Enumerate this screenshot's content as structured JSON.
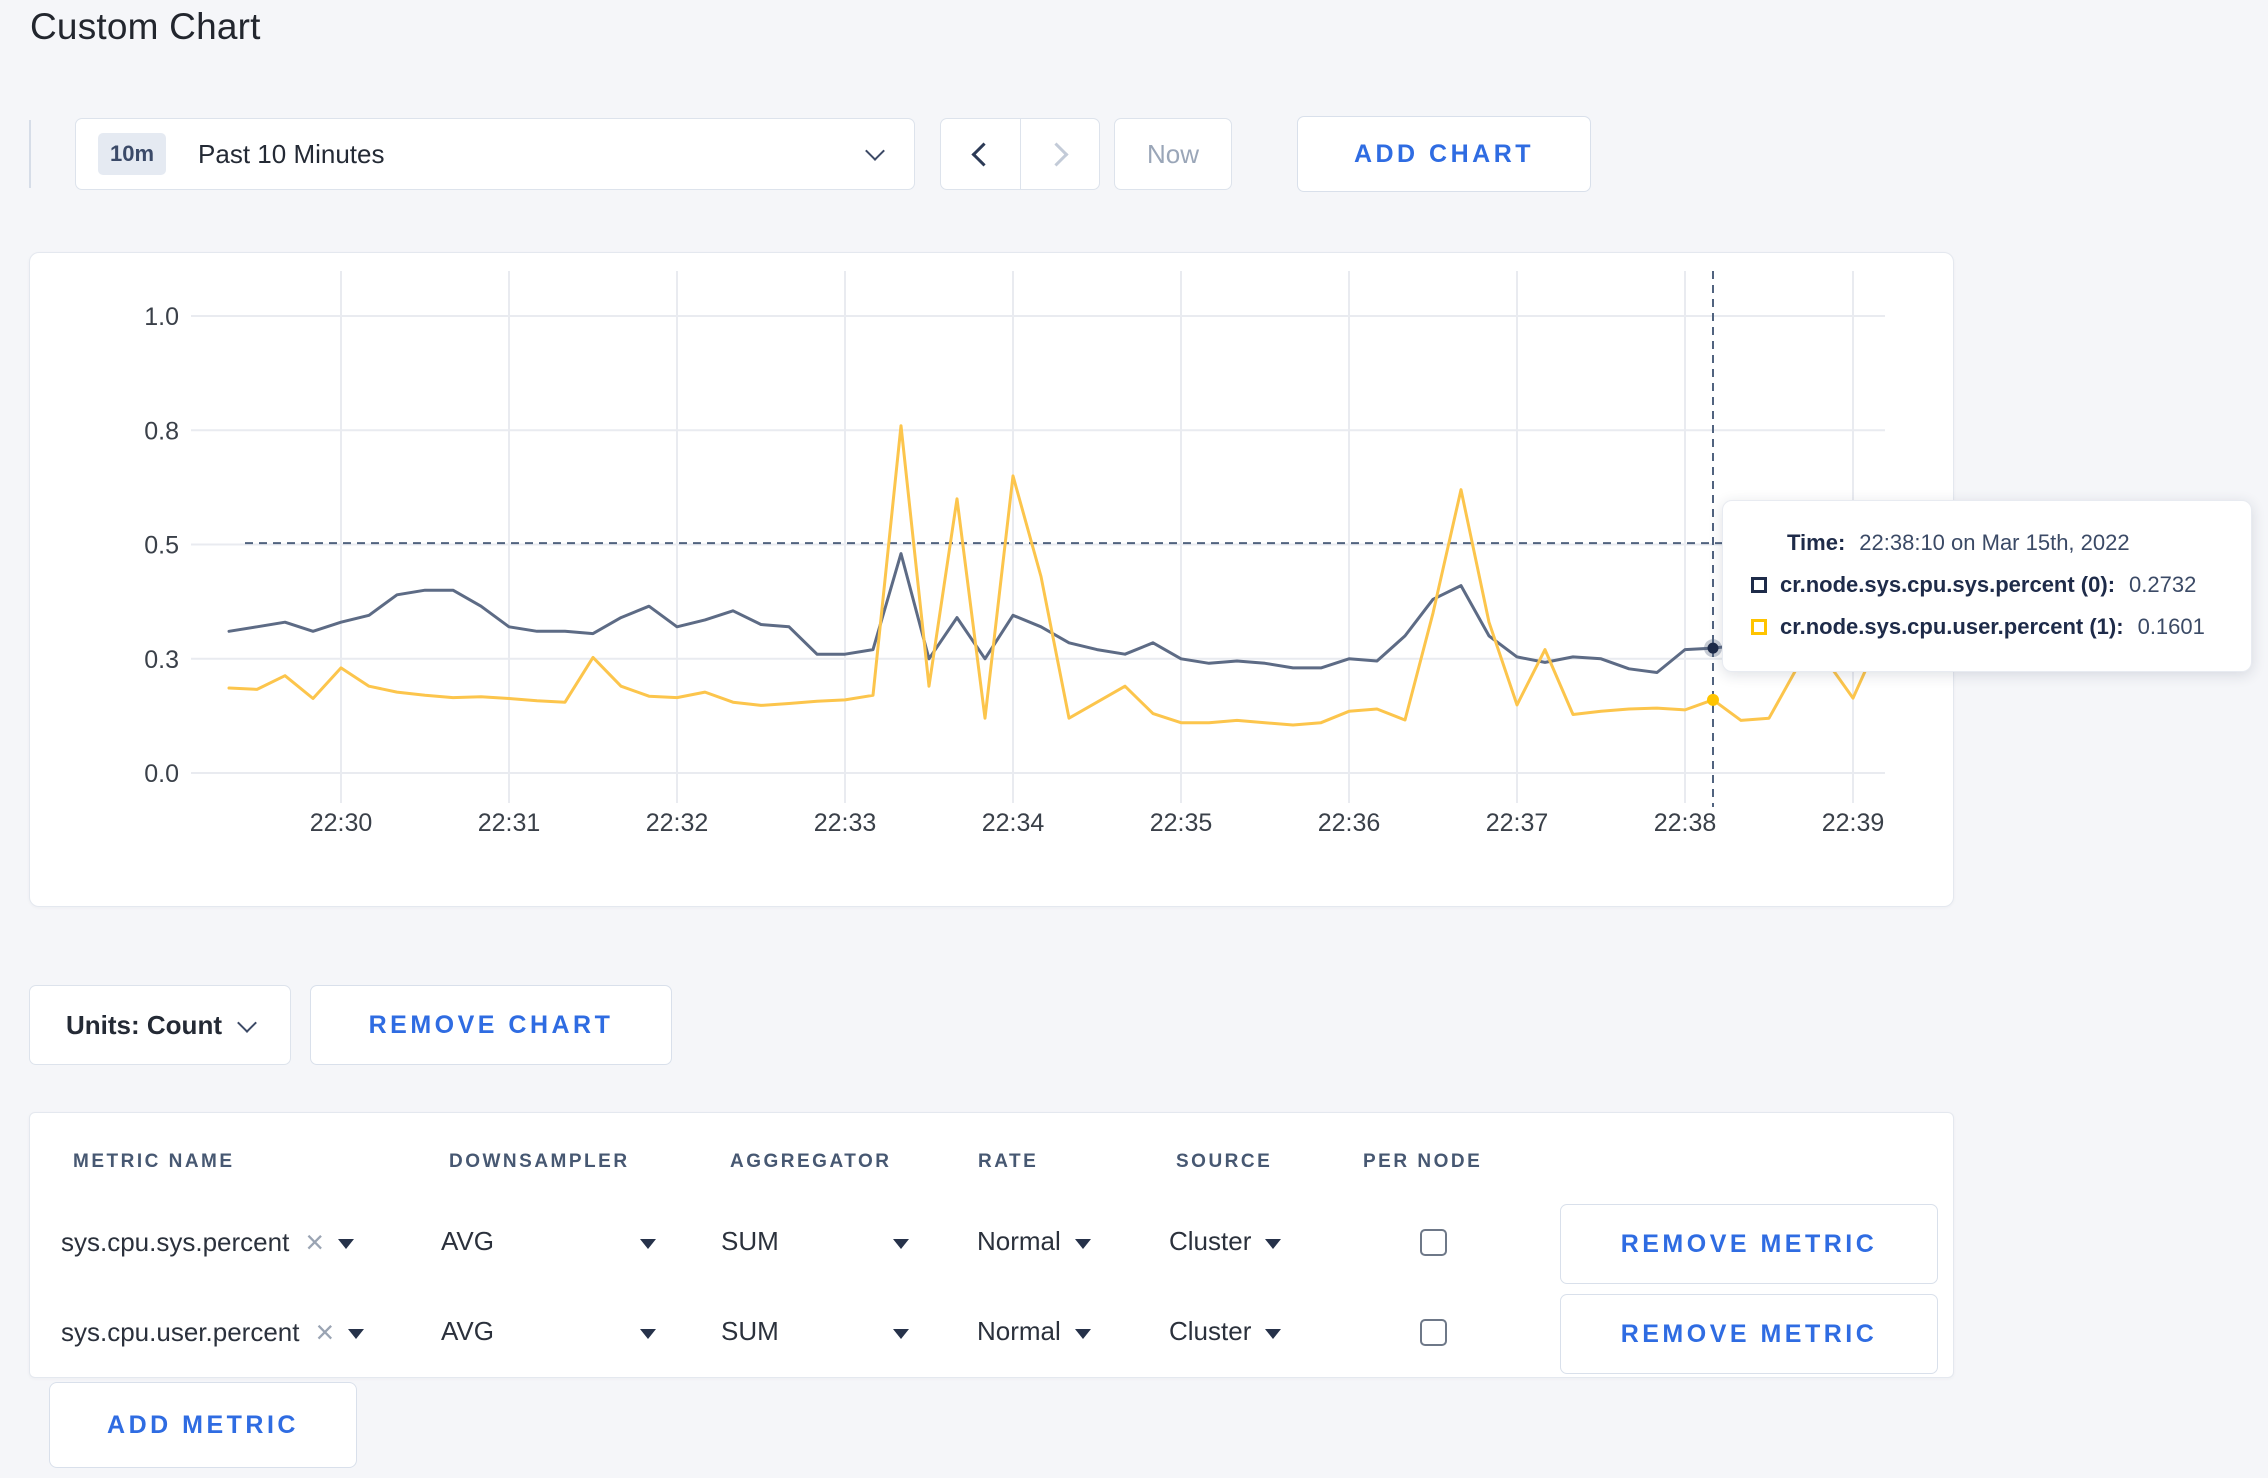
{
  "page": {
    "title": "Custom Chart"
  },
  "toolbar": {
    "time_window_badge": "10m",
    "time_window_label": "Past 10 Minutes",
    "now_label": "Now",
    "add_chart_label": "ADD CHART"
  },
  "tooltip": {
    "time_label": "Time:",
    "time_value": "22:38:10 on Mar 15th, 2022",
    "series": [
      {
        "name": "cr.node.sys.cpu.sys.percent (0):",
        "value": "0.2732",
        "color": "#1e2b49"
      },
      {
        "name": "cr.node.sys.cpu.user.percent (1):",
        "value": "0.1601",
        "color": "#ffc400"
      }
    ]
  },
  "chart_footer": {
    "units_label": "Units: Count",
    "remove_chart_label": "REMOVE CHART"
  },
  "metrics_table": {
    "headers": [
      "METRIC NAME",
      "DOWNSAMPLER",
      "AGGREGATOR",
      "RATE",
      "SOURCE",
      "PER NODE"
    ],
    "rows": [
      {
        "metric": "sys.cpu.sys.percent",
        "downsampler": "AVG",
        "aggregator": "SUM",
        "rate": "Normal",
        "source": "Cluster",
        "per_node_checked": false,
        "remove_label": "REMOVE METRIC"
      },
      {
        "metric": "sys.cpu.user.percent",
        "downsampler": "AVG",
        "aggregator": "SUM",
        "rate": "Normal",
        "source": "Cluster",
        "per_node_checked": false,
        "remove_label": "REMOVE METRIC"
      }
    ],
    "add_metric_label": "ADD METRIC"
  },
  "chart_data": {
    "type": "line",
    "title": "",
    "xlabel": "",
    "ylabel": "",
    "ylim": [
      0.0,
      1.0
    ],
    "grid": true,
    "legend_position": "none",
    "y_tick_values": [
      1.0,
      0.75,
      0.5,
      0.25,
      0.0
    ],
    "y_tick_labels": [
      "1.0",
      "0.8",
      "0.5",
      "0.3",
      "0.0"
    ],
    "x_ticks": [
      "22:30",
      "22:31",
      "22:32",
      "22:33",
      "22:34",
      "22:35",
      "22:36",
      "22:37",
      "22:38",
      "22:39"
    ],
    "crosshair": {
      "time": "22:38:10",
      "hline_value": 0.503,
      "sys_value": 0.2732,
      "user_value": 0.1601
    },
    "colors": {
      "sys": "#5d6b85",
      "user": "#fcc54c",
      "grid": "#e9ebf0",
      "dashed": "#51637f",
      "axis_label": "#3a4049"
    },
    "series": [
      {
        "name": "cr.node.sys.cpu.sys.percent",
        "color": "#5d6b85",
        "points": [
          [
            "22:29:20",
            0.31
          ],
          [
            "22:29:30",
            0.32
          ],
          [
            "22:29:40",
            0.33
          ],
          [
            "22:29:50",
            0.31
          ],
          [
            "22:30:00",
            0.33
          ],
          [
            "22:30:10",
            0.345
          ],
          [
            "22:30:20",
            0.39
          ],
          [
            "22:30:30",
            0.4
          ],
          [
            "22:30:40",
            0.4
          ],
          [
            "22:30:50",
            0.365
          ],
          [
            "22:31:00",
            0.32
          ],
          [
            "22:31:10",
            0.31
          ],
          [
            "22:31:20",
            0.31
          ],
          [
            "22:31:30",
            0.305
          ],
          [
            "22:31:40",
            0.34
          ],
          [
            "22:31:50",
            0.365
          ],
          [
            "22:32:00",
            0.32
          ],
          [
            "22:32:10",
            0.335
          ],
          [
            "22:32:20",
            0.355
          ],
          [
            "22:32:30",
            0.325
          ],
          [
            "22:32:40",
            0.32
          ],
          [
            "22:32:50",
            0.26
          ],
          [
            "22:33:00",
            0.26
          ],
          [
            "22:33:10",
            0.27
          ],
          [
            "22:33:20",
            0.48
          ],
          [
            "22:33:30",
            0.25
          ],
          [
            "22:33:40",
            0.34
          ],
          [
            "22:33:50",
            0.25
          ],
          [
            "22:34:00",
            0.345
          ],
          [
            "22:34:10",
            0.32
          ],
          [
            "22:34:20",
            0.285
          ],
          [
            "22:34:30",
            0.27
          ],
          [
            "22:34:40",
            0.26
          ],
          [
            "22:34:50",
            0.285
          ],
          [
            "22:35:00",
            0.25
          ],
          [
            "22:35:10",
            0.24
          ],
          [
            "22:35:20",
            0.245
          ],
          [
            "22:35:30",
            0.24
          ],
          [
            "22:35:40",
            0.23
          ],
          [
            "22:35:50",
            0.23
          ],
          [
            "22:36:00",
            0.25
          ],
          [
            "22:36:10",
            0.245
          ],
          [
            "22:36:20",
            0.3
          ],
          [
            "22:36:30",
            0.38
          ],
          [
            "22:36:40",
            0.41
          ],
          [
            "22:36:50",
            0.3
          ],
          [
            "22:37:00",
            0.254
          ],
          [
            "22:37:10",
            0.242
          ],
          [
            "22:37:20",
            0.254
          ],
          [
            "22:37:30",
            0.25
          ],
          [
            "22:37:40",
            0.228
          ],
          [
            "22:37:50",
            0.22
          ],
          [
            "22:38:00",
            0.27
          ],
          [
            "22:38:10",
            0.2732
          ],
          [
            "22:38:20",
            0.28
          ],
          [
            "22:38:30",
            0.3
          ],
          [
            "22:38:40",
            0.31
          ],
          [
            "22:38:50",
            0.3
          ],
          [
            "22:39:00",
            0.295
          ],
          [
            "22:39:10",
            0.3
          ],
          [
            "22:39:20",
            0.31
          ]
        ]
      },
      {
        "name": "cr.node.sys.cpu.user.percent",
        "color": "#fcc54c",
        "points": [
          [
            "22:29:20",
            0.186
          ],
          [
            "22:29:30",
            0.183
          ],
          [
            "22:29:40",
            0.213
          ],
          [
            "22:29:50",
            0.163
          ],
          [
            "22:30:00",
            0.23
          ],
          [
            "22:30:10",
            0.19
          ],
          [
            "22:30:20",
            0.177
          ],
          [
            "22:30:30",
            0.17
          ],
          [
            "22:30:40",
            0.165
          ],
          [
            "22:30:50",
            0.167
          ],
          [
            "22:31:00",
            0.163
          ],
          [
            "22:31:10",
            0.158
          ],
          [
            "22:31:20",
            0.155
          ],
          [
            "22:31:30",
            0.253
          ],
          [
            "22:31:40",
            0.19
          ],
          [
            "22:31:50",
            0.168
          ],
          [
            "22:32:00",
            0.165
          ],
          [
            "22:32:10",
            0.177
          ],
          [
            "22:32:20",
            0.155
          ],
          [
            "22:32:30",
            0.148
          ],
          [
            "22:32:40",
            0.152
          ],
          [
            "22:32:50",
            0.157
          ],
          [
            "22:33:00",
            0.16
          ],
          [
            "22:33:10",
            0.17
          ],
          [
            "22:33:20",
            0.76
          ],
          [
            "22:33:30",
            0.19
          ],
          [
            "22:33:40",
            0.6
          ],
          [
            "22:33:50",
            0.12
          ],
          [
            "22:34:00",
            0.65
          ],
          [
            "22:34:10",
            0.43
          ],
          [
            "22:34:20",
            0.12
          ],
          [
            "22:34:30",
            0.155
          ],
          [
            "22:34:40",
            0.19
          ],
          [
            "22:34:50",
            0.13
          ],
          [
            "22:35:00",
            0.11
          ],
          [
            "22:35:10",
            0.11
          ],
          [
            "22:35:20",
            0.115
          ],
          [
            "22:35:30",
            0.11
          ],
          [
            "22:35:40",
            0.105
          ],
          [
            "22:35:50",
            0.11
          ],
          [
            "22:36:00",
            0.135
          ],
          [
            "22:36:10",
            0.14
          ],
          [
            "22:36:20",
            0.116
          ],
          [
            "22:36:30",
            0.35
          ],
          [
            "22:36:40",
            0.62
          ],
          [
            "22:36:50",
            0.33
          ],
          [
            "22:37:00",
            0.149
          ],
          [
            "22:37:10",
            0.27
          ],
          [
            "22:37:20",
            0.128
          ],
          [
            "22:37:30",
            0.135
          ],
          [
            "22:37:40",
            0.14
          ],
          [
            "22:37:50",
            0.142
          ],
          [
            "22:38:00",
            0.138
          ],
          [
            "22:38:10",
            0.1601
          ],
          [
            "22:38:20",
            0.115
          ],
          [
            "22:38:30",
            0.12
          ],
          [
            "22:38:40",
            0.23
          ],
          [
            "22:38:50",
            0.25
          ],
          [
            "22:39:00",
            0.164
          ],
          [
            "22:39:10",
            0.3
          ],
          [
            "22:39:20",
            0.27
          ]
        ]
      }
    ]
  }
}
